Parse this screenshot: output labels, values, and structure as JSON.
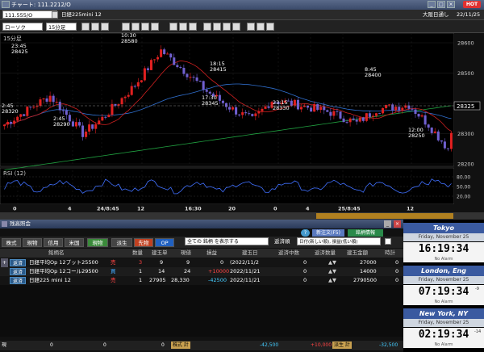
{
  "window": {
    "title": "チャート: 111.2212/O",
    "hot_label": "HOT"
  },
  "toolbar": {
    "symbol_code": "111.555/O",
    "symbol_name": "日経225mini 12",
    "exchange": "大阪日通し",
    "date": "22/11/25",
    "chart_type": "ローソク",
    "interval": "15分足"
  },
  "chart": {
    "interval_label": "15分足",
    "rsi_label": "RSI (12)",
    "price_axis": [
      "28600",
      "28500",
      "28400",
      "28300",
      "28200"
    ],
    "price_marker": "28325",
    "rsi_axis": [
      "80.00",
      "50.00",
      "20.00"
    ],
    "time_axis": [
      "0",
      "4",
      "24/8:45",
      "12",
      "16:30",
      "20",
      "0",
      "4",
      "25/8:45",
      "12"
    ],
    "annotations": [
      {
        "time": "23:45",
        "price": "28425"
      },
      {
        "time": "2:45",
        "price": "28320"
      },
      {
        "time": "2:45",
        "price": "28290"
      },
      {
        "time": "10:30",
        "price": "28580"
      },
      {
        "time": "17:30",
        "price": "28345"
      },
      {
        "time": "18:15",
        "price": "28415"
      },
      {
        "time": "23:15",
        "price": "28330"
      },
      {
        "time": "8:45",
        "price": "28400"
      },
      {
        "time": "12:00",
        "price": "28250"
      }
    ]
  },
  "order_panel": {
    "title": "残高照会",
    "top_buttons": [
      "新注文(F5)",
      "銘柄情報"
    ],
    "tabs": [
      "株式",
      "現物",
      "信用",
      "米国",
      "現物",
      "派生",
      "先物",
      "OP"
    ],
    "filter_all": "全ての 銘柄 を表示する",
    "sort_label": "返済順",
    "sort_value": "日付(新しい順), 損益(低い順)",
    "headers": [
      "銘柄名",
      "数量",
      "建玉単",
      "現値",
      "損益",
      "建玉日",
      "返済中数",
      "返済数量",
      "建玉金額",
      "時計"
    ],
    "rows": [
      {
        "action": "返済",
        "name": "日経平均Op 12プット25500",
        "side": "売",
        "qty": "3",
        "unit": "9",
        "price": "9",
        "pl": "0",
        "date": "(2022/11/2",
        "closing": "0",
        "amount": "27000",
        "time": "0"
      },
      {
        "action": "返済",
        "name": "日経平均Op 12コール29500",
        "side": "買",
        "qty": "1",
        "unit": "14",
        "price": "24",
        "pl": "+10000",
        "date": "2022/11/21",
        "closing": "0",
        "amount": "14000",
        "time": "0"
      },
      {
        "action": "返済",
        "name": "日経225 mini 12",
        "side": "売",
        "qty": "1",
        "unit": "27905",
        "price": "28,330",
        "pl": "-42500",
        "date": "2022/11/21",
        "closing": "0",
        "amount": "2790500",
        "time": "0"
      }
    ],
    "footer": {
      "label_left": "現",
      "val1": "0",
      "val2": "0",
      "label_mid": "株式 計",
      "val3": "-42,500",
      "val4": "+10,000",
      "label_deriv": "派生 計",
      "val5": "-32,500"
    }
  },
  "clocks": [
    {
      "city": "Tokyo",
      "date": "Friday, November 25",
      "time": "16:19:34",
      "offset": "",
      "alarm": "No Alarm"
    },
    {
      "city": "London, Eng",
      "date": "Friday, November 25",
      "time": "07:19:34",
      "offset": "-9",
      "alarm": "No Alarm"
    },
    {
      "city": "New York, NY",
      "date": "Friday, November 25",
      "time": "02:19:34",
      "offset": "-14",
      "alarm": "No Alarm"
    }
  ],
  "colors": {
    "bullish": "#e02020",
    "bearish": "#7060d0",
    "ma_short": "#d02020",
    "ma_mid": "#3070d0",
    "ma_long": "#20a040",
    "rsi": "#4070ff"
  }
}
